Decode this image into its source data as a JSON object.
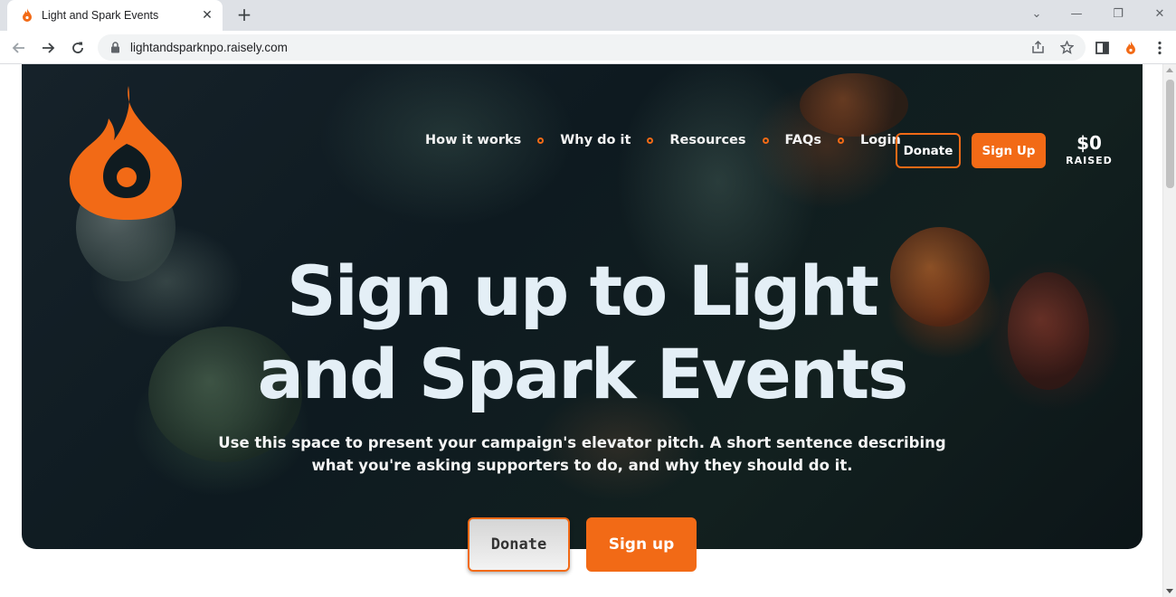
{
  "browser": {
    "tab_title": "Light and Spark Events",
    "tab_close": "✕",
    "new_tab": "+",
    "url": "lightandsparknpo.raisely.com",
    "window_controls": {
      "minimize": "—",
      "restore": "❐",
      "close": "✕",
      "tab_search": "⌄"
    },
    "icons": [
      "back-icon",
      "forward-icon",
      "reload-icon",
      "lock-icon",
      "share-icon",
      "star-icon",
      "sidepanel-icon",
      "extension-icon",
      "menu-icon"
    ]
  },
  "site": {
    "brand_color": "#f26a16",
    "nav": {
      "links": [
        "How it works",
        "Why do it",
        "Resources",
        "FAQs",
        "Login"
      ],
      "donate": "Donate",
      "signup": "Sign Up"
    },
    "raised": {
      "amount": "$0",
      "label": "RAISED"
    },
    "hero": {
      "headline_line1": "Sign up to Light",
      "headline_line2": "and Spark Events",
      "subtext_line1": "Use this space to present your campaign's elevator pitch. A short sentence describing",
      "subtext_line2": "what you're asking supporters to do, and why they should do it.",
      "donate_label": "Donate",
      "signup_label": "Sign up"
    }
  }
}
